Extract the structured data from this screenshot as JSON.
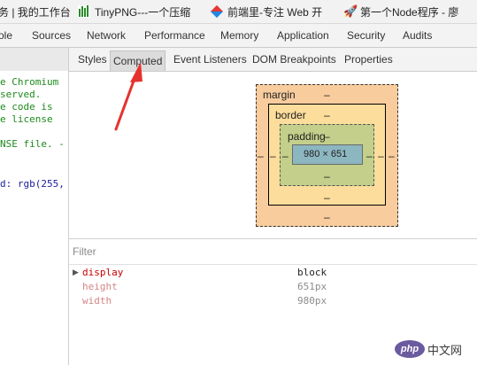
{
  "bookmarks": [
    {
      "label": "务 | 我的工作台",
      "icon": "bookmark-icon"
    },
    {
      "label": "TinyPNG---一个压缩",
      "icon": "bar-chart-icon"
    },
    {
      "label": "前端里-专注 Web 开",
      "icon": "diamond-icon"
    },
    {
      "label": "第一个Node程序 - 廖",
      "icon": "rocket-icon"
    }
  ],
  "devtools_tabs": [
    "ole",
    "Sources",
    "Network",
    "Performance",
    "Memory",
    "Application",
    "Security",
    "Audits"
  ],
  "source_lines": [
    {
      "text": "e Chromium",
      "color": "green"
    },
    {
      "text": "served.",
      "color": "green"
    },
    {
      "text": "e code is",
      "color": "green"
    },
    {
      "text": "e license",
      "color": "green"
    },
    {
      "text": "",
      "color": "green"
    },
    {
      "text": "NSE file. -",
      "color": "green"
    },
    {
      "text": "",
      "color": "green"
    },
    {
      "text": "",
      "color": "green"
    },
    {
      "text": "d: rgb(255,",
      "color": "blue"
    }
  ],
  "sub_tabs": [
    "Styles",
    "Computed",
    "Event Listeners",
    "DOM Breakpoints",
    "Properties"
  ],
  "active_sub_tab": "Computed",
  "box_model": {
    "margin_label": "margin",
    "border_label": "border",
    "padding_label": "padding",
    "dash": "–",
    "content_size": "980 × 651"
  },
  "filter": {
    "placeholder": "Filter",
    "value": ""
  },
  "properties": [
    {
      "name": "display",
      "value": "block",
      "inherited": false,
      "expandable": true
    },
    {
      "name": "height",
      "value": "651px",
      "inherited": true,
      "expandable": false
    },
    {
      "name": "width",
      "value": "980px",
      "inherited": true,
      "expandable": false
    }
  ],
  "watermark": {
    "logo": "php",
    "text": "中文网"
  },
  "colors": {
    "margin": "#f8cc9d",
    "border": "#fddd9b",
    "padding": "#c3cf8a",
    "content": "#8cb6c0",
    "arrow": "#e5322d",
    "property_name": "#c80000"
  }
}
